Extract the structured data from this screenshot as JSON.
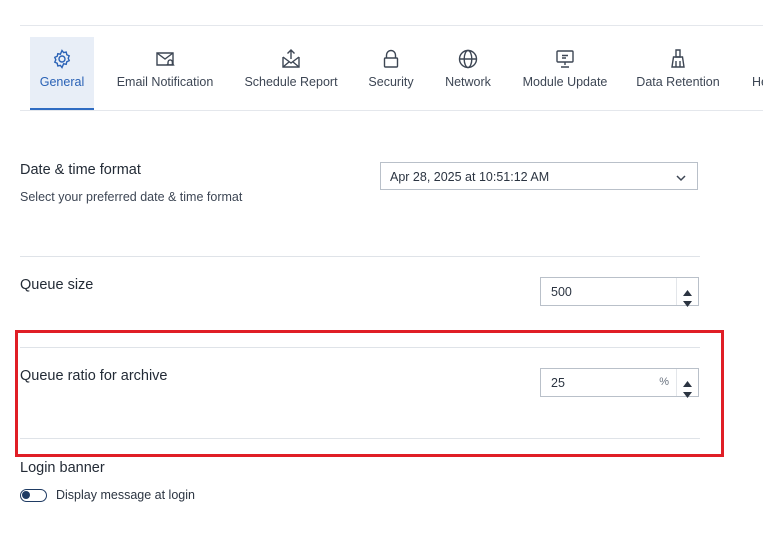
{
  "tabs": [
    {
      "label": "General",
      "icon": "gear-icon",
      "active": true
    },
    {
      "label": "Email Notification",
      "icon": "envelope-bell-icon"
    },
    {
      "label": "Schedule Report",
      "icon": "envelope-upload-icon"
    },
    {
      "label": "Security",
      "icon": "lock-icon"
    },
    {
      "label": "Network",
      "icon": "globe-icon"
    },
    {
      "label": "Module Update",
      "icon": "monitor-update-icon"
    },
    {
      "label": "Data Retention",
      "icon": "broom-icon"
    },
    {
      "label": "He",
      "icon": "cut-off-tab-icon"
    }
  ],
  "colors": {
    "accent": "#2f6cc2",
    "active_tab_bg": "#e8eef7",
    "highlight_border": "#e01e26"
  },
  "settings": {
    "date_time": {
      "title": "Date & time format",
      "description": "Select your preferred date & time format",
      "value": "Apr 28, 2025 at 10:51:12 AM"
    },
    "queue_size": {
      "title": "Queue size",
      "value": "500"
    },
    "queue_ratio": {
      "title": "Queue ratio for archive",
      "value": "25",
      "unit": "%"
    },
    "login_banner": {
      "title": "Login banner",
      "toggle_label": "Display message at login",
      "enabled": false
    }
  }
}
